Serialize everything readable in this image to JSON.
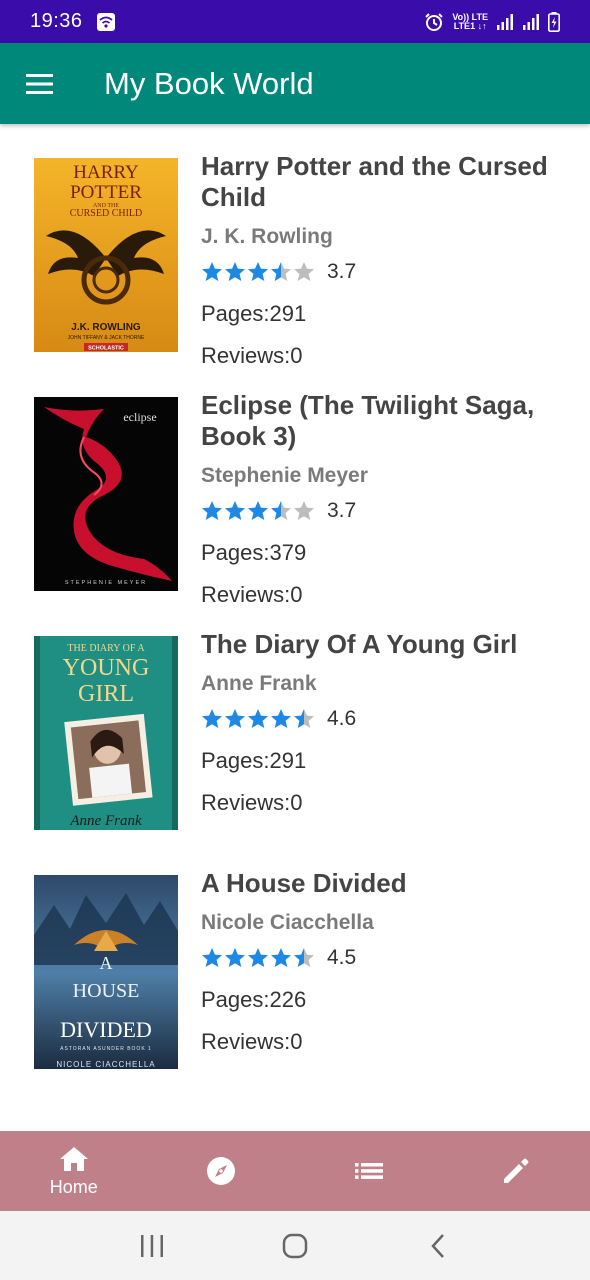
{
  "status_bar": {
    "time": "19:36",
    "net_top": "Vo)) LTE",
    "net_bottom": "LTE1 ↓↑"
  },
  "app_bar": {
    "title": "My Book World"
  },
  "books": [
    {
      "title": "Harry Potter and the Cursed Child",
      "author": "J. K. Rowling",
      "rating": "3.7",
      "pages": "Pages:291",
      "reviews": "Reviews:0",
      "cover": {
        "line1": "HARRY",
        "line2": "POTTER",
        "line3": "AND THE",
        "line4": "CURSED CHILD",
        "author": "J.K. ROWLING",
        "sub": "JOHN TIFFANY & JACK THORNE",
        "publisher": "SCHOLASTIC"
      }
    },
    {
      "title": "Eclipse (The Twilight Saga, Book 3)",
      "author": "Stephenie Meyer",
      "rating": "3.7",
      "pages": "Pages:379",
      "reviews": "Reviews:0",
      "cover": {
        "title": "eclipse",
        "author": "STEPHENIE MEYER"
      }
    },
    {
      "title": "The Diary Of A Young Girl",
      "author": "Anne Frank",
      "rating": "4.6",
      "pages": "Pages:291",
      "reviews": "Reviews:0",
      "cover": {
        "line1": "THE DIARY OF A",
        "line2": "YOUNG",
        "line3": "GIRL",
        "signature": "Anne Frank"
      }
    },
    {
      "title": "A House Divided",
      "author": "Nicole Ciacchella",
      "rating": "4.5",
      "pages": "Pages:226",
      "reviews": "Reviews:0",
      "cover": {
        "line1": "A",
        "line2": "HOUSE",
        "line3": "DIVIDED",
        "series": "ASTORAN ASUNDER BOOK 1",
        "author": "NICOLE CIACCHELLA"
      }
    }
  ],
  "bottom_nav": {
    "home_label": "Home"
  },
  "colors": {
    "status_bar": "#3a0dab",
    "app_bar": "#00897b",
    "bottom_nav": "#c0808a",
    "star_filled": "#1e88e5",
    "star_empty": "#bdbdbd"
  },
  "icons": [
    "wifi-icon",
    "alarm-icon",
    "signal-icon",
    "battery-icon",
    "menu-icon",
    "home-icon",
    "compass-icon",
    "list-icon",
    "edit-icon",
    "recents-icon",
    "home-circle-icon",
    "back-icon"
  ]
}
